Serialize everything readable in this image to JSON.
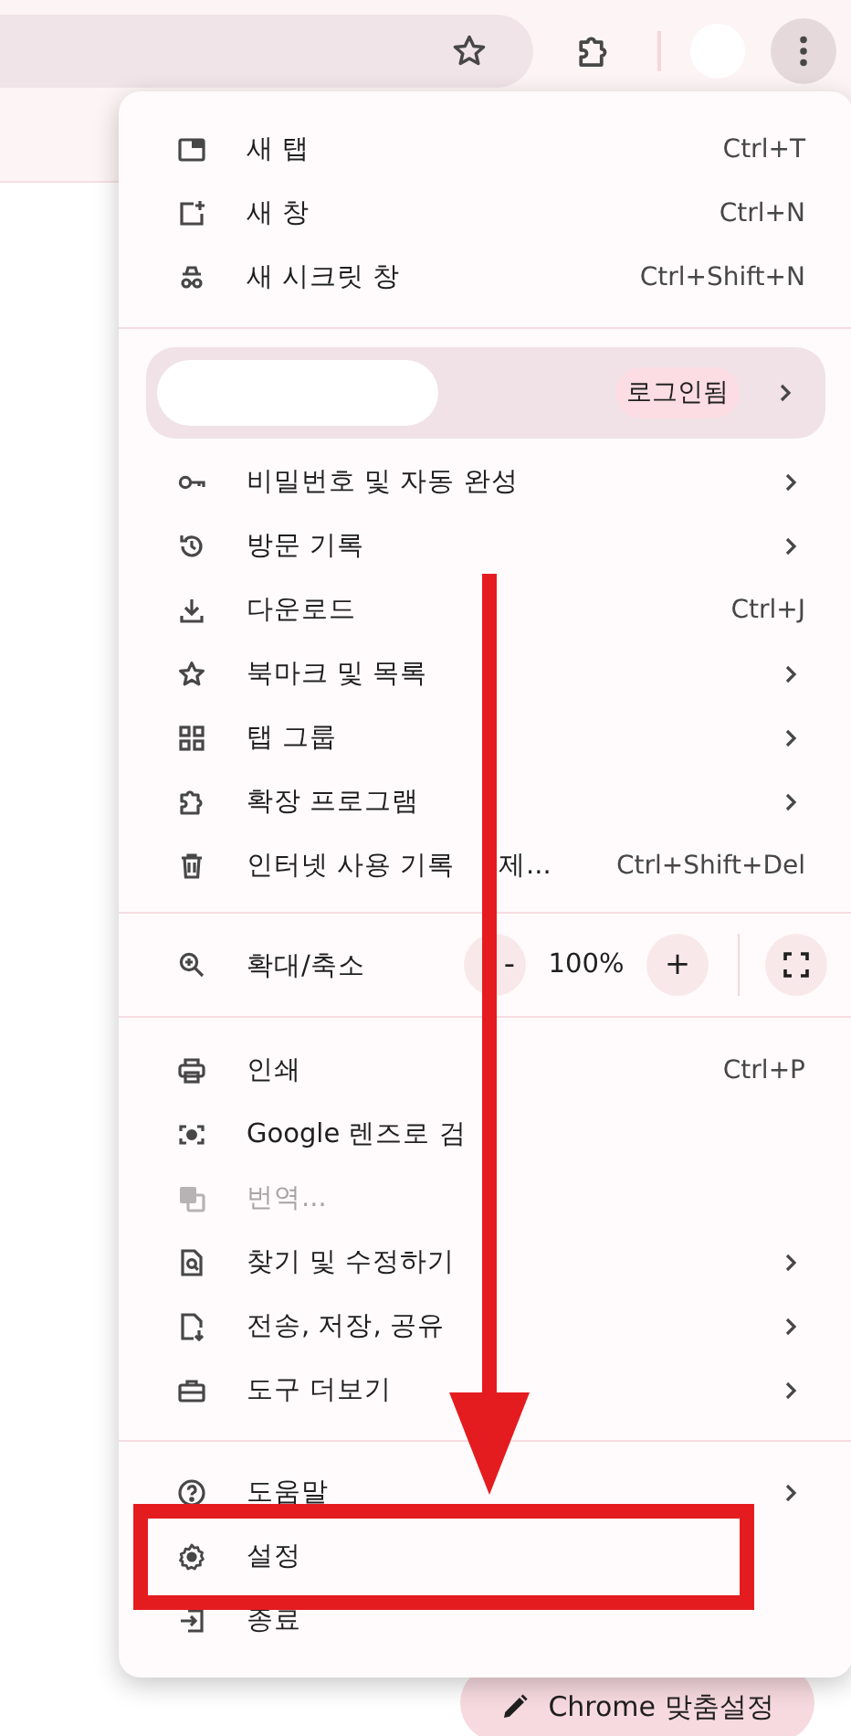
{
  "menu": {
    "new_items": [
      {
        "label": "새 탭",
        "shortcut": "Ctrl+T"
      },
      {
        "label": "새 창",
        "shortcut": "Ctrl+N"
      },
      {
        "label": "새 시크릿 창",
        "shortcut": "Ctrl+Shift+N"
      }
    ],
    "profile": {
      "badge": "로그인됨"
    },
    "features": [
      {
        "label": "비밀번호 및 자동 완성",
        "submenu": true
      },
      {
        "label": "방문 기록",
        "submenu": true
      },
      {
        "label": "다운로드",
        "shortcut": "Ctrl+J",
        "submenu": false
      },
      {
        "label": "북마크 및 목록",
        "submenu": true
      },
      {
        "label": "탭 그룹",
        "submenu": true
      },
      {
        "label": "확장 프로그램",
        "submenu": true
      },
      {
        "label": "인터넷 사용 기록",
        "label_tail": "제...",
        "shortcut": "Ctrl+Shift+Del",
        "submenu": false
      }
    ],
    "zoom": {
      "label": "확대/축소",
      "zoom_out": "-",
      "value": "100%",
      "zoom_in": "+"
    },
    "tools": [
      {
        "label": "인쇄",
        "shortcut": "Ctrl+P",
        "submenu": false,
        "disabled": false
      },
      {
        "label": "Google 렌즈로 검",
        "submenu": false,
        "disabled": false
      },
      {
        "label": "번역...",
        "submenu": false,
        "disabled": true
      },
      {
        "label": "찾기 및 수정하기",
        "submenu": true,
        "disabled": false
      },
      {
        "label": "전송, 저장, 공유",
        "submenu": true,
        "disabled": false
      },
      {
        "label": "도구 더보기",
        "submenu": true,
        "disabled": false
      }
    ],
    "help": [
      {
        "label": "도움말",
        "submenu": true
      },
      {
        "label": "설정",
        "submenu": false
      },
      {
        "label": "종료",
        "submenu": false
      }
    ]
  },
  "customize_button": "Chrome 맞춤설정"
}
